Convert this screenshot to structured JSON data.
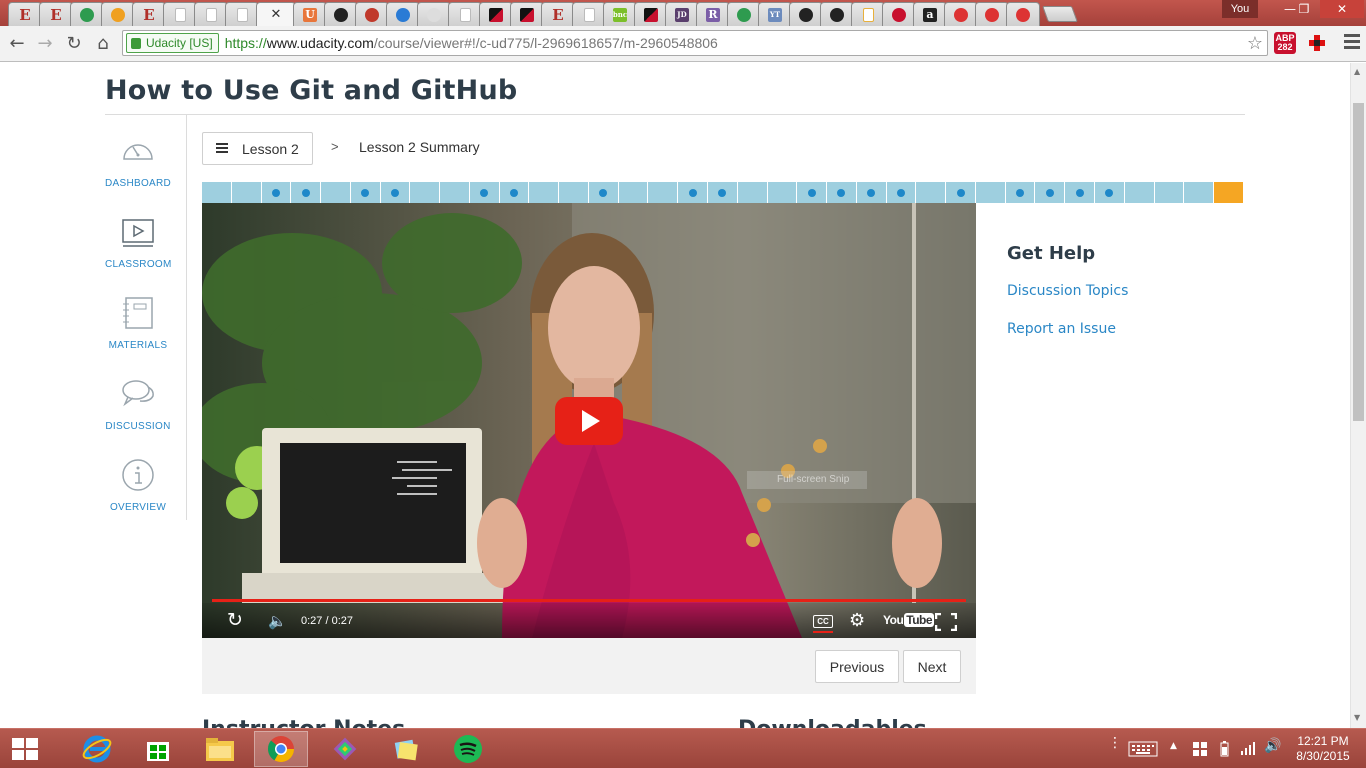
{
  "browser": {
    "user_label": "You",
    "window_controls": {
      "minimize": "—",
      "restore": "❐",
      "close": "✕"
    },
    "tabs": [
      {
        "icon": "E",
        "color": "#b0302a"
      },
      {
        "icon": "E",
        "color": "#b0302a"
      },
      {
        "icon": "sheet",
        "color": "#2e9b4f"
      },
      {
        "icon": "bulb",
        "color": "#f0a020"
      },
      {
        "icon": "E",
        "color": "#b0302a"
      },
      {
        "icon": "doc",
        "color": "#bbbbbb"
      },
      {
        "icon": "doc",
        "color": "#bbbbbb"
      },
      {
        "icon": "doc",
        "color": "#bbbbbb"
      },
      {
        "icon": "close",
        "active": true
      },
      {
        "icon": "U",
        "color": "#e8763b"
      },
      {
        "icon": "github",
        "color": "#222222"
      },
      {
        "icon": "pin",
        "color": "#c0392b"
      },
      {
        "icon": "pinwheel",
        "color": "#2a7bd5"
      },
      {
        "icon": "fan",
        "color": "#dddddd"
      },
      {
        "icon": "doc",
        "color": "#bbbbbb"
      },
      {
        "icon": "redblack",
        "color": "#c8102e"
      },
      {
        "icon": "redblack",
        "color": "#c8102e"
      },
      {
        "icon": "E",
        "color": "#b0302a"
      },
      {
        "icon": "doc",
        "color": "#bbbbbb"
      },
      {
        "icon": "bnc",
        "color": "#7cbf2a"
      },
      {
        "icon": "redblack",
        "color": "#c8102e"
      },
      {
        "icon": "JD",
        "color": "#5a3f6d"
      },
      {
        "icon": "R",
        "color": "#7b5ea7"
      },
      {
        "icon": "leaf",
        "color": "#2e9b4f"
      },
      {
        "icon": "YT",
        "color": "#6c8bbd"
      },
      {
        "icon": "play",
        "color": "#222222"
      },
      {
        "icon": "github",
        "color": "#222222"
      },
      {
        "icon": "doc",
        "color": "#e8b03b"
      },
      {
        "icon": "bars",
        "color": "#c8102e"
      },
      {
        "icon": "a",
        "color": "#222222"
      },
      {
        "icon": "rec",
        "color": "#d33"
      },
      {
        "icon": "rec",
        "color": "#d33"
      },
      {
        "icon": "rec",
        "color": "#d33"
      }
    ],
    "active_tab_close": "✕",
    "identity": "Udacity [US]",
    "url_scheme": "https://",
    "url_host": "www.udacity.com",
    "url_path": "/course/viewer#!/c-ud775/l-2969618657/m-2960548806",
    "abp_count": "282"
  },
  "page": {
    "title": "How to Use Git and GitHub",
    "nav": [
      {
        "label": "DASHBOARD",
        "icon": "gauge-icon"
      },
      {
        "label": "CLASSROOM",
        "icon": "play-screen-icon"
      },
      {
        "label": "MATERIALS",
        "icon": "notebook-icon"
      },
      {
        "label": "DISCUSSION",
        "icon": "chat-bubbles-icon"
      },
      {
        "label": "OVERVIEW",
        "icon": "info-icon"
      }
    ],
    "lesson_button": "Lesson 2",
    "breadcrumb_sep": ">",
    "breadcrumb_current": "Lesson 2 Summary",
    "progress": {
      "segments": 35,
      "dots": [
        3,
        4,
        6,
        7,
        10,
        11,
        14,
        17,
        18,
        21,
        22,
        23,
        24,
        26,
        28,
        29,
        30,
        31
      ],
      "current_segment": 35
    },
    "video": {
      "tooltip": "Full-screen Snip",
      "time": "0:27 / 0:27",
      "cc": "CC",
      "youtube_you": "You",
      "youtube_tube": "Tube",
      "progress": 1.0
    },
    "previous_label": "Previous",
    "next_label": "Next",
    "help": {
      "title": "Get Help",
      "links": [
        "Discussion Topics",
        "Report an Issue"
      ]
    },
    "cut_headings": [
      "Instructor Notes",
      "Downloadables"
    ]
  },
  "taskbar": {
    "apps": [
      "Internet Explorer",
      "Store",
      "File Explorer",
      "Chrome",
      "Maps",
      "Sticky Notes",
      "Spotify"
    ],
    "clock_time": "12:21 PM",
    "clock_date": "8/30/2015"
  }
}
